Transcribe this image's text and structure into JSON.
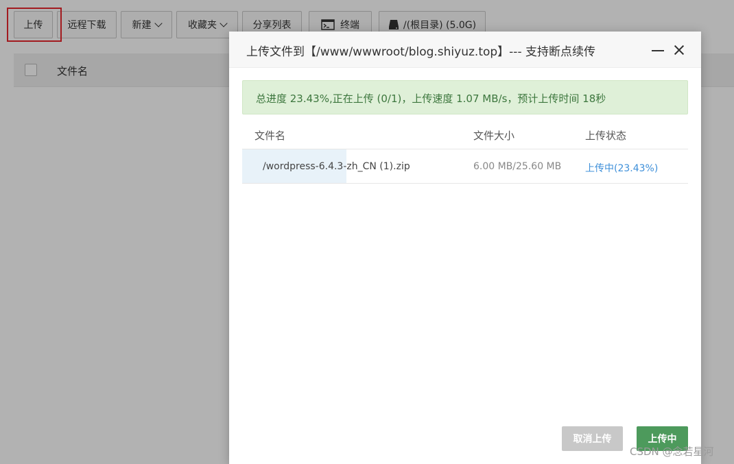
{
  "toolbar": {
    "upload": "上传",
    "remote_download": "远程下载",
    "new": "新建",
    "favorites": "收藏夹",
    "share_list": "分享列表",
    "terminal": "终端",
    "disk": "/(根目录) (5.0G)"
  },
  "file_list": {
    "column_name": "文件名"
  },
  "dialog": {
    "title": "上传文件到【/www/wwwroot/blog.shiyuz.top】--- 支持断点续传",
    "progress_text": "总进度 23.43%,正在上传 (0/1)，上传速度 1.07 MB/s，预计上传时间 18秒",
    "progress_fraction": 0.2343,
    "columns": {
      "name": "文件名",
      "size": "文件大小",
      "status": "上传状态"
    },
    "rows": [
      {
        "name": "/wordpress-6.4.3-zh_CN (1).zip",
        "size": "6.00 MB/25.60 MB",
        "status": "上传中(23.43%)"
      }
    ],
    "cancel_button": "取消上传",
    "upload_button": "上传中"
  },
  "watermark": "CSDN @念若星河",
  "colors": {
    "highlight": "#e8262d",
    "progress_bg": "#dff0d8",
    "progress_text": "#3c763d",
    "status_link": "#3d8fd9",
    "primary_button": "#4d9a5c"
  },
  "icons": {
    "terminal": "terminal-icon",
    "disk": "hard-drive-icon",
    "minimize": "minimize-icon",
    "close": "close-icon"
  }
}
